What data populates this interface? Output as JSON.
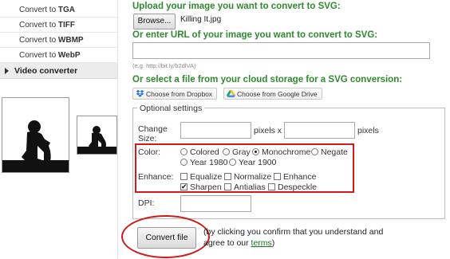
{
  "sidebar": {
    "items": [
      {
        "prefix": "Convert to ",
        "bold": "TGA"
      },
      {
        "prefix": "Convert to ",
        "bold": "TIFF"
      },
      {
        "prefix": "Convert to ",
        "bold": "WBMP"
      },
      {
        "prefix": "Convert to ",
        "bold": "WebP"
      }
    ],
    "section_label": "Video converter"
  },
  "upload": {
    "heading": "Upload your image you want to convert to SVG:",
    "browse_label": "Browse...",
    "file_name": "Killing It.jpg"
  },
  "url": {
    "heading": "Or enter URL of your image you want to convert to SVG:",
    "value": "",
    "hint": "(e.g. http://bit.ly/b2dlVA)"
  },
  "cloud": {
    "heading": "Or select a file from your cloud storage for a SVG conversion:",
    "dropbox_label": "Choose from Dropbox",
    "gdrive_label": "Choose from Google Drive"
  },
  "optional": {
    "legend": "Optional settings",
    "change_size_label": "Change Size:",
    "width_value": "",
    "height_value": "",
    "pixels_x": "pixels x",
    "pixels": "pixels",
    "color_label": "Color:",
    "color_options": [
      {
        "label": "Colored",
        "selected": false
      },
      {
        "label": "Gray",
        "selected": false
      },
      {
        "label": "Monochrome",
        "selected": true
      },
      {
        "label": "Negate",
        "selected": false
      },
      {
        "label": "Year 1980",
        "selected": false
      },
      {
        "label": "Year 1900",
        "selected": false
      }
    ],
    "enhance_label": "Enhance:",
    "enhance_options": [
      {
        "label": "Equalize",
        "checked": false
      },
      {
        "label": "Normalize",
        "checked": false
      },
      {
        "label": "Enhance",
        "checked": false
      },
      {
        "label": "Sharpen",
        "checked": true
      },
      {
        "label": "Antialias",
        "checked": false
      },
      {
        "label": "Despeckle",
        "checked": false
      }
    ],
    "dpi_label": "DPI:",
    "dpi_value": ""
  },
  "submit": {
    "convert_label": "Convert file",
    "notice_line1": "(by clicking you confirm that you understand and",
    "notice_line2_pre": "agree to our ",
    "terms_link": "terms",
    "notice_line2_post": ")"
  },
  "colors": {
    "heading_green": "#2f8a2f",
    "annotation_red": "#d11a1a"
  }
}
